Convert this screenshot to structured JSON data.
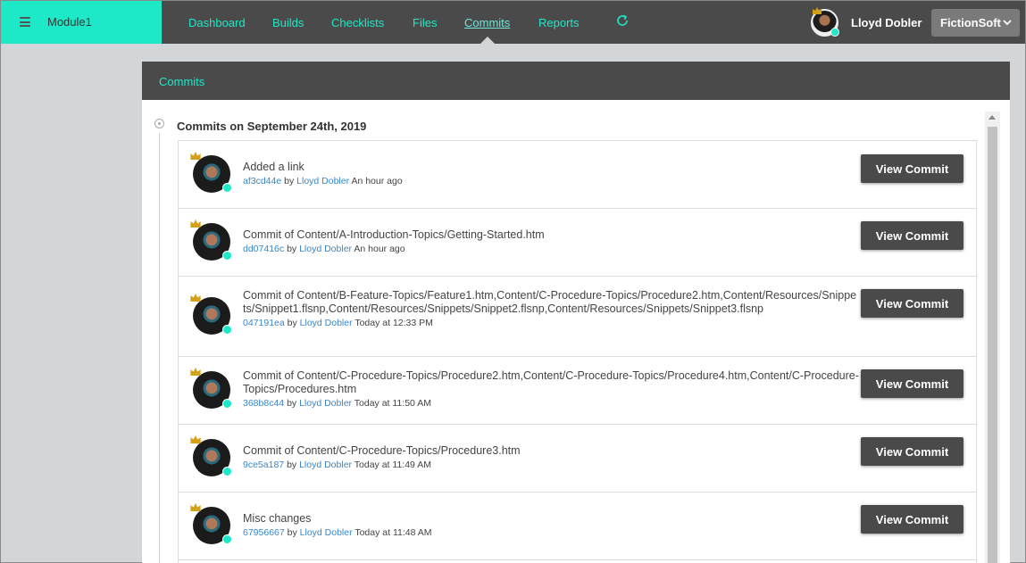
{
  "app": {
    "module_title": "Module1"
  },
  "nav": {
    "items": [
      {
        "label": "Dashboard"
      },
      {
        "label": "Builds"
      },
      {
        "label": "Checklists"
      },
      {
        "label": "Files"
      },
      {
        "label": "Commits",
        "active": true
      },
      {
        "label": "Reports"
      }
    ],
    "refresh_icon": "refresh-icon"
  },
  "user": {
    "name": "Lloyd Dobler",
    "company": "FictionSoft"
  },
  "colors": {
    "accent": "#1de9c9",
    "dark": "#4a4a4a",
    "link": "#3a86c8"
  },
  "panel": {
    "title": "Commits",
    "day_heading": "Commits on September 24th, 2019",
    "view_label": "View Commit",
    "commits": [
      {
        "message": "Added a link",
        "hash": "af3cd44e",
        "by": "by",
        "author": "Lloyd Dobler",
        "time": "An hour ago"
      },
      {
        "message": "Commit of Content/A-Introduction-Topics/Getting-Started.htm",
        "hash": "dd07416c",
        "by": "by",
        "author": "Lloyd Dobler",
        "time": "An hour ago"
      },
      {
        "message": "Commit of Content/B-Feature-Topics/Feature1.htm,Content/C-Procedure-Topics/Procedure2.htm,Content/Resources/Snippets/Snippet1.flsnp,Content/Resources/Snippets/Snippet2.flsnp,Content/Resources/Snippets/Snippet3.flsnp",
        "hash": "047191ea",
        "by": "by",
        "author": "Lloyd Dobler",
        "time": "Today at 12:33 PM"
      },
      {
        "message": "Commit of Content/C-Procedure-Topics/Procedure2.htm,Content/C-Procedure-Topics/Procedure4.htm,Content/C-Procedure-Topics/Procedures.htm",
        "hash": "368b8c44",
        "by": "by",
        "author": "Lloyd Dobler",
        "time": "Today at 11:50 AM"
      },
      {
        "message": "Commit of Content/C-Procedure-Topics/Procedure3.htm",
        "hash": "9ce5a187",
        "by": "by",
        "author": "Lloyd Dobler",
        "time": "Today at 11:49 AM"
      },
      {
        "message": "Misc changes",
        "hash": "67956667",
        "by": "by",
        "author": "Lloyd Dobler",
        "time": "Today at 11:48 AM"
      }
    ]
  }
}
